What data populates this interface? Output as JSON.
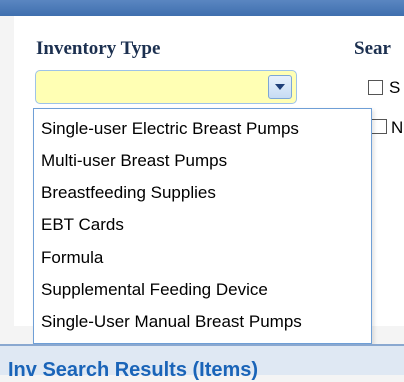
{
  "form": {
    "inventory_type_label": "Inventory Type",
    "search_label_partial": "Sear",
    "selected_value": "",
    "checkbox_1_text": "S",
    "checkbox_2_text": "N"
  },
  "dropdown": {
    "options": [
      "Single-user Electric Breast Pumps",
      "Multi-user Breast Pumps",
      "Breastfeeding Supplies",
      "EBT Cards",
      "Formula",
      "Supplemental Feeding Device",
      "Single-User Manual Breast Pumps"
    ]
  },
  "footer": {
    "partial_title": "Inv Search Results (Items)"
  },
  "colors": {
    "select_bg": "#ffffb4",
    "title_text": "#1c3050",
    "accent_blue": "#3f6fae"
  },
  "icons": {
    "dropdown_button": "chevron-down-icon"
  }
}
